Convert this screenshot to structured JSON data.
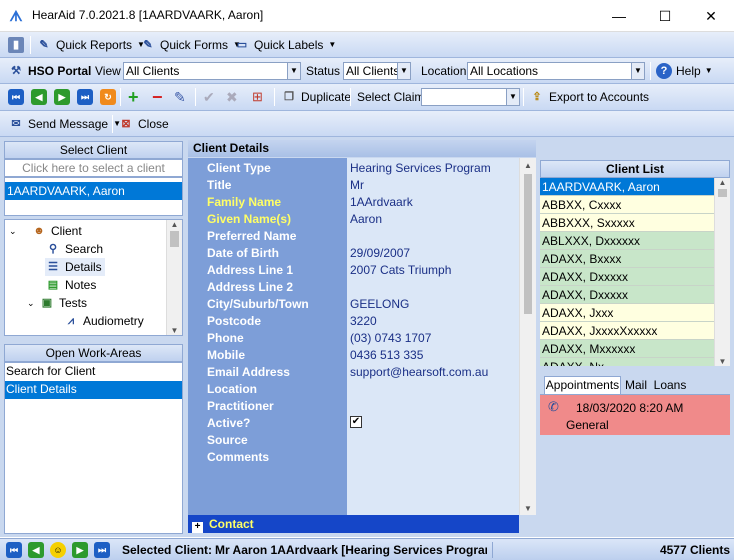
{
  "window": {
    "title": "HearAid 7.0.2021.8  [1AARDVAARK, Aaron]",
    "minimize": "—",
    "maximize": "☐",
    "close": "✕"
  },
  "toolbar1": {
    "quick_reports": "Quick Reports",
    "quick_forms": "Quick Forms",
    "quick_labels": "Quick Labels"
  },
  "toolbar2": {
    "portal": "HSO Portal",
    "view_label": "View",
    "view_value": "All Clients",
    "status_label": "Status",
    "status_value": "All Clients",
    "location_label": "Location",
    "location_value": "All Locations",
    "help": "Help"
  },
  "toolbar3": {
    "duplicate": "Duplicate",
    "select_claim": "Select Claim",
    "select_claim_value": "",
    "export": "Export to Accounts"
  },
  "toolbar4": {
    "send_message": "Send Message",
    "close": "Close"
  },
  "left": {
    "select_client_header": "Select Client",
    "select_client_hint": "Click here to select a client",
    "selected_client": "1AARDVAARK, Aaron",
    "tree": [
      {
        "label": "Client",
        "icon": "person-icon"
      },
      {
        "label": "Search",
        "icon": "magnifier-icon"
      },
      {
        "label": "Details",
        "icon": "list-icon"
      },
      {
        "label": "Notes",
        "icon": "notes-icon"
      },
      {
        "label": "Tests",
        "icon": "image-icon"
      },
      {
        "label": "Audiometry",
        "icon": "chart-icon"
      }
    ],
    "work_areas_header": "Open Work-Areas",
    "work_areas": [
      "Search for Client",
      "Client Details"
    ]
  },
  "details": {
    "header": "Client Details",
    "fields": [
      {
        "label": "Client Type",
        "value": "Hearing Services Program"
      },
      {
        "label": "Title",
        "value": "Mr"
      },
      {
        "label": "Family Name",
        "value": "1AArdvaark"
      },
      {
        "label": "Given Name(s)",
        "value": "Aaron"
      },
      {
        "label": "Preferred Name",
        "value": ""
      },
      {
        "label": "Date of Birth",
        "value": "29/09/2007"
      },
      {
        "label": "Address Line 1",
        "value": "2007 Cats Triumph"
      },
      {
        "label": "Address Line 2",
        "value": ""
      },
      {
        "label": "City/Suburb/Town",
        "value": "GEELONG"
      },
      {
        "label": "Postcode",
        "value": "3220"
      },
      {
        "label": "Phone",
        "value": "(03) 0743 1707"
      },
      {
        "label": "Mobile",
        "value": "0436 513 335"
      },
      {
        "label": "Email Address",
        "value": "support@hearsoft.com.au"
      },
      {
        "label": "Location",
        "value": ""
      },
      {
        "label": "Practitioner",
        "value": ""
      },
      {
        "label": "Active?",
        "value": "✔"
      },
      {
        "label": "Source",
        "value": ""
      },
      {
        "label": "Comments",
        "value": ""
      }
    ],
    "contact_section": "Contact",
    "expand_glyph": "+"
  },
  "client_list": {
    "header": "Client List",
    "rows": [
      "1AARDVAARK, Aaron",
      "ABBXX, Cxxxx",
      "ABBXXX, Sxxxxx",
      "ABLXXX, Dxxxxxx",
      "ADAXX, Bxxxx",
      "ADAXX, Dxxxxx",
      "ADAXX, Dxxxxx",
      "ADAXX, Jxxx",
      "ADAXX, JxxxxXxxxxx",
      "ADAXX, Mxxxxxx",
      "ADAXX, Nx..."
    ],
    "tabs": [
      "Appointments",
      "Mail",
      "Loans"
    ],
    "appointment": {
      "datetime": "18/03/2020 8:20 AM",
      "type": "General"
    }
  },
  "statusbar": {
    "selected_label": "Selected Client:",
    "selected_value": "Mr Aaron 1AArdvaark [Hearing Services Progran",
    "count": "4577 Clients"
  },
  "colors": {
    "accent": "#0078d7",
    "label_panel": "#7d9ed8",
    "value_panel": "#dbe7f7",
    "required_label": "#ffff66",
    "appointment": "#f08a8a"
  }
}
